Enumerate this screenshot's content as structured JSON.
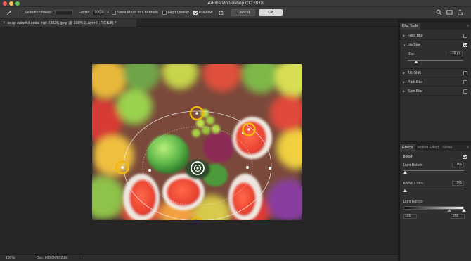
{
  "app": {
    "title": "Adobe Photoshop CC 2018"
  },
  "options": {
    "selection_bleed_label": "Selection Bleed:",
    "selection_bleed_value": "",
    "focus_label": "Focus:",
    "focus_value": "100%",
    "save_mask_label": "Save Mask to Channels",
    "save_mask_checked": false,
    "high_quality_label": "High Quality",
    "high_quality_checked": false,
    "preview_label": "Preview",
    "preview_checked": true,
    "cancel_label": "Cancel",
    "ok_label": "OK"
  },
  "document": {
    "tab_title": "soap-colorful-color-fruit-68525.jpeg @ 100% (Layer 0, RGB/8) *",
    "close_glyph": "×"
  },
  "status": {
    "zoom": "100%",
    "doc_info": "Doc: 600.0K/832.8K",
    "arrow": "›"
  },
  "blur_tools": {
    "tab_label": "Blur Tools",
    "items": [
      {
        "name": "Field Blur",
        "checked": false,
        "expanded": false
      },
      {
        "name": "Iris Blur",
        "checked": true,
        "expanded": true
      },
      {
        "name": "Tilt-Shift",
        "checked": false,
        "expanded": false
      },
      {
        "name": "Path Blur",
        "checked": false,
        "expanded": false
      },
      {
        "name": "Spin Blur",
        "checked": false,
        "expanded": false
      }
    ],
    "iris": {
      "blur_label": "Blur:",
      "blur_value": "15 px",
      "blur_level": 0.15
    }
  },
  "effects": {
    "tabs": [
      "Effects",
      "Motion Effect",
      "Noise"
    ],
    "bokeh_label": "Bokeh",
    "bokeh_checked": true,
    "light_bokeh_label": "Light Bokeh:",
    "light_bokeh_value": "0%",
    "bokeh_color_label": "Bokeh Color:",
    "bokeh_color_value": "0%",
    "light_range_label": "Light Range:",
    "light_range_low": "191",
    "light_range_high": "255"
  },
  "colors": {
    "pin_yellow": "#f2b90a",
    "ok_button": "#d9d9d9",
    "canvas_bg": "#262626"
  }
}
